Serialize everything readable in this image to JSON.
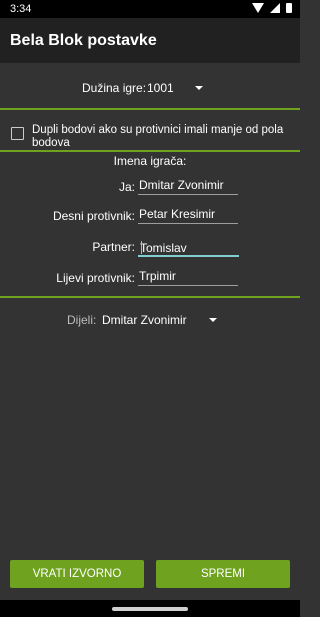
{
  "status_bar": {
    "time": "3:34"
  },
  "app_bar": {
    "title": "Bela Blok postavke"
  },
  "game_length": {
    "label": "Dužina igre:",
    "value": "1001"
  },
  "double_points": {
    "text": "Dupli bodovi ako su protivnici imali manje od pola bodova",
    "checked": false
  },
  "players": {
    "title": "Imena igrača:",
    "me": {
      "label": "Ja:",
      "value": "Dmitar Zvonimir"
    },
    "right_opponent": {
      "label": "Desni protivnik:",
      "value": "Petar Kresimir"
    },
    "partner": {
      "label": "Partner:",
      "value": "Tomislav"
    },
    "left_opponent": {
      "label": "Lijevi protivnik:",
      "value": "Trpimir"
    }
  },
  "dealer": {
    "label": "Dijeli:",
    "value": "Dmitar Zvonimir"
  },
  "buttons": {
    "reset": "VRATI IZVORNO",
    "save": "SPREMI"
  },
  "colors": {
    "accent": "#6fa31f",
    "background": "#333333",
    "appbar": "#212121",
    "focus": "#7fd1cf"
  }
}
